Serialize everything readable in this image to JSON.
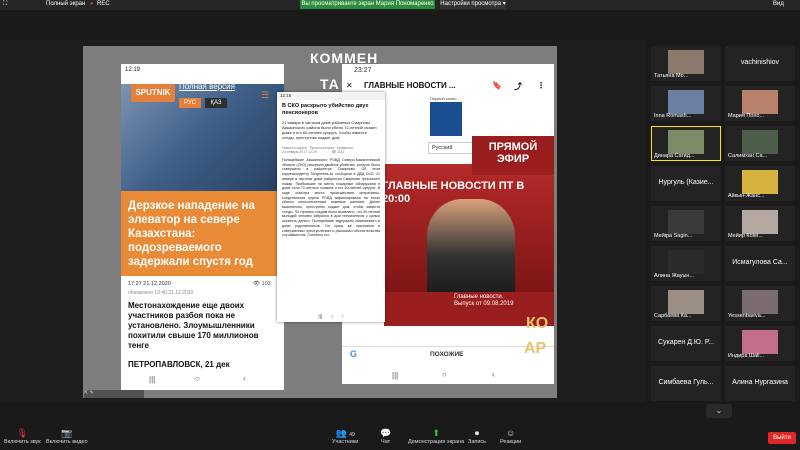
{
  "topbar": {
    "fullscreen": "Полный экран",
    "rec": "REC",
    "share_banner": "Вы просматриваете экран Мария Пономаренко",
    "view_options": "Настройки просмотра ▾",
    "view": "Вид"
  },
  "slide": {
    "title_line1": "КОММЕН",
    "title_line2": "ТА",
    "right_text1": "КО",
    "right_text2": "АР"
  },
  "phone1": {
    "time": "12:19",
    "logo": "SPUTNIK",
    "full_version": "Полная версия",
    "lang_ru": "РУС",
    "lang_kz": "ҚАЗ",
    "headline": "Дерзкое нападение на элеватор на севере Казахстана: подозреваемого задержали спустя год",
    "meta_time": "17:27 21.12.2020",
    "meta_updated": "обновлено 13:40 21.12.2020",
    "views": "103",
    "headline2": "Местонахождение еще двоих участников разбоя пока не установлено. Злоумышленники похитили свыше 170 миллионов тенге",
    "city": "ПЕТРОПАВЛОВСК, 21 дек"
  },
  "phone2": {
    "time": "12:18",
    "title": "В СКО раскрыто убийство двух пенсионеров",
    "lead": "21 января в частном доме районных Смирново Акжаинского района были убиты 72-летний хозяин дома и его 60-летняя супруга. Чтобы замести следы, преступник поджег дом.",
    "crumb": "Новости округа · Происшествия · Криминал",
    "date": "24 января 2017 12:29",
    "views": "1112",
    "body": "Полицейские Акжаинского РОВД Северо-Казахстанской области (СКО) раскрыли двойное убийство, которое было совершено в райцентре Смирново. Об этом корреспонденту Tengrinews.kz сообщили в ДВД СКО. 21 января в частном доме райцентра Смирново произошел пожар. Прибывшие на место пожарные обнаружили в доме тела 72-летнего хозяина и его 60-летней супруги. В ходе осмотра места происшествия оперативно-следственная группа РОВД зафиксировала на телах убитых многочисленные ножевые ранения. Далее выяснилось, преступник поджег дом, чтобы замести следы. По горячим следам было выявлено, что 20-летний молодой человек забрался в дом пенсионеров с целью похитить деньги. Полицейские задержали обвиняемого в доме родственников. Он сразу же признался в совершенных преступлениях и рассказал обстоятельства случившегося. Согласно его"
  },
  "phone3": {
    "time": "23:27",
    "top_title": "ГЛАВНЫЕ НОВОСТИ ...",
    "channel": "Первый канал ЕВРАЗИЯ",
    "select": "Русский",
    "live": "ПРЯМОЙ ЭФИР",
    "banner": "ГЛАВНЫЕ НОВОСТИ ПТ В 20:00",
    "news": "Главные новости. Выпуск от 09.08.2019",
    "similar": "ПОХОЖИЕ",
    "google": "G"
  },
  "participants": [
    {
      "name": "Татьяна Мо...",
      "type": "video",
      "color": "#8b7a6b"
    },
    {
      "name": "vachinishiov",
      "type": "name"
    },
    {
      "name": "Inna Romash...",
      "type": "video",
      "color": "#6b7fa3"
    },
    {
      "name": "Мария Поно...",
      "type": "video",
      "color": "#b9826c"
    },
    {
      "name": "Динара Сагид...",
      "type": "video",
      "color": "#7d8a66",
      "active": true
    },
    {
      "name": "Салимхан Са...",
      "type": "video",
      "color": "#4d5e4a"
    },
    {
      "name": "Нургуль (Казие...",
      "type": "name"
    },
    {
      "name": "Айкын-Жанс...",
      "type": "video",
      "color": "#d6b23e"
    },
    {
      "name": "Мейіра Sagin...",
      "type": "video",
      "color": "#3a3a3a"
    },
    {
      "name": "Мейир Коlei...",
      "type": "video",
      "color": "#b4a7a1"
    },
    {
      "name": "Алина Жауын...",
      "type": "video",
      "color": "#2b2b2b"
    },
    {
      "name": "Исмагулова Са...",
      "type": "name"
    },
    {
      "name": "Сарбаева Ка...",
      "type": "video",
      "color": "#9b8f86"
    },
    {
      "name": "Yessenbaeva...",
      "type": "video",
      "color": "#7a6c70"
    },
    {
      "name": "Сукарен Д.Ю. Р...",
      "type": "name"
    },
    {
      "name": "Индира Шаlі...",
      "type": "video",
      "color": "#c46e8a"
    },
    {
      "name": "Симбаева Гуль...",
      "type": "name"
    },
    {
      "name": "Алина Нургазина",
      "type": "name"
    }
  ],
  "toolbar": {
    "mute": "Включить звук",
    "video": "Включить видео",
    "participants_count": "49",
    "participants": "Участники",
    "chat": "Чат",
    "share": "Демонстрация экрана",
    "record": "Запись",
    "reactions": "Реакции",
    "exit": "Выйти"
  }
}
